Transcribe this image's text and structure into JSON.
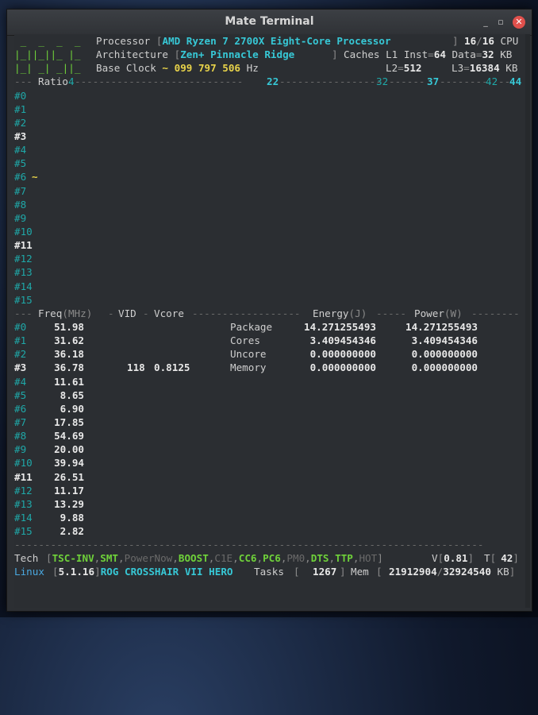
{
  "window": {
    "title": "Mate Terminal",
    "minimize": "_",
    "maximize": "▫",
    "close": "✕"
  },
  "header": {
    "logo": [
      " _  _  _  _",
      "|_||_||_ |_",
      "|_| _| _||_"
    ],
    "proc_label": "Processor",
    "proc_value": "AMD Ryzen 7 2700X Eight-Core Processor",
    "cpu_online": "16",
    "cpu_total": "16",
    "cpu_label": "CPU",
    "arch_label": "Architecture",
    "arch_value": "Zen+ Pinnacle Ridge",
    "caches_label": "Caches L1 Inst",
    "l1_inst": "64",
    "data_label": "Data",
    "l1_data": "32",
    "kb": "KB",
    "clock_label": "Base Clock",
    "clock_prefix": "~",
    "clock_value": "099 797 506",
    "hz": "Hz",
    "l2_label": "L2",
    "l2": "512",
    "l3_label": "L3",
    "l3": "16384"
  },
  "ratio": {
    "label": "Ratio",
    "marks": [
      "4",
      "22",
      "32",
      "37",
      "42",
      "44"
    ],
    "tilde": "~"
  },
  "cores": [
    "#0",
    "#1",
    "#2",
    "#3",
    "#4",
    "#5",
    "#6",
    "#7",
    "#8",
    "#9",
    "#10",
    "#11",
    "#12",
    "#13",
    "#14",
    "#15"
  ],
  "freq_header": {
    "freq": "Freq",
    "mhz": "MHz",
    "vid": "VID",
    "vcore": "Vcore",
    "energy": "Energy",
    "joule": "J",
    "power": "Power",
    "watt": "W"
  },
  "freqs": [
    "51.98",
    "31.62",
    "36.18",
    "36.78",
    "11.61",
    "8.65",
    "6.90",
    "17.85",
    "54.69",
    "20.00",
    "39.94",
    "26.51",
    "11.17",
    "13.29",
    "9.88",
    "2.82"
  ],
  "vid": "118",
  "vcore": "0.8125",
  "power_rows": [
    {
      "name": "Package",
      "energy": "14.271255493",
      "power": "14.271255493"
    },
    {
      "name": "Cores",
      "energy": "3.409454346",
      "power": "3.409454346"
    },
    {
      "name": "Uncore",
      "energy": "0.000000000",
      "power": "0.000000000"
    },
    {
      "name": "Memory",
      "energy": "0.000000000",
      "power": "0.000000000"
    }
  ],
  "tech": {
    "label": "Tech",
    "flags": [
      {
        "name": "TSC-INV",
        "on": true
      },
      {
        "name": "SMT",
        "on": true
      },
      {
        "name": "PowerNow",
        "on": false
      },
      {
        "name": "BOOST",
        "on": true
      },
      {
        "name": "C1E",
        "on": false
      },
      {
        "name": "CC6",
        "on": true
      },
      {
        "name": "PC6",
        "on": true
      },
      {
        "name": "PM0",
        "on": false
      },
      {
        "name": "DTS",
        "on": true
      },
      {
        "name": "TTP",
        "on": true
      },
      {
        "name": "HOT",
        "on": false
      }
    ],
    "v_label": "V",
    "v_value": "0.81",
    "t_label": "T",
    "t_value": "42"
  },
  "status": {
    "os": "Linux",
    "kernel": "5.1.16",
    "board": "ROG CROSSHAIR VII HERO",
    "tasks_label": "Tasks",
    "tasks": "1267",
    "mem_label": "Mem",
    "mem_used": "21912904",
    "mem_total": "32924540",
    "kb": "KB"
  },
  "colors": {
    "accent": "#37c8d6",
    "on_flag": "#6fd23a",
    "yellow": "#e8d34a"
  }
}
